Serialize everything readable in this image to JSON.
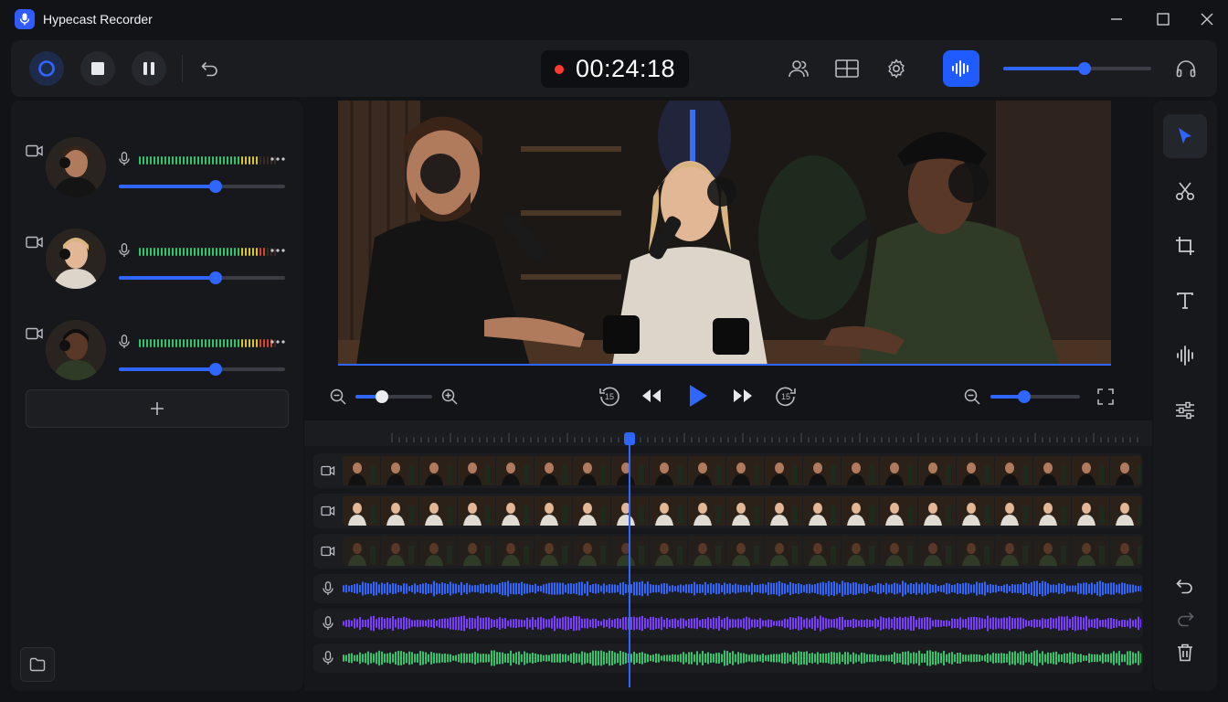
{
  "window": {
    "title": "Hypecast Recorder",
    "minimize_icon": "minimize-icon",
    "maximize_icon": "maximize-icon",
    "close_icon": "close-icon"
  },
  "toolbar": {
    "buttons": [
      "record-icon",
      "stop-icon",
      "pause-icon",
      "undo-icon"
    ],
    "timer": "00:24:18",
    "recording_indicator_color": "#ff3b30",
    "right_icons": [
      "participants-icon",
      "layout-icon",
      "settings-icon",
      "audio-wave-icon",
      "headphones-icon"
    ],
    "output_volume": 0.55
  },
  "participants": [
    {
      "meter_level": 0.85,
      "volume": 0.58
    },
    {
      "meter_level": 0.9,
      "volume": 0.58
    },
    {
      "meter_level": 0.95,
      "volume": 0.58
    }
  ],
  "sidebar": {
    "add_icon": "plus-icon",
    "folder_icon": "folder-icon"
  },
  "preview": {
    "zoom_level": 0.35,
    "skip_back_label": "15",
    "skip_forward_label": "15",
    "timeline_zoom": 0.38
  },
  "timeline": {
    "video_tracks": 3,
    "audio_tracks": [
      {
        "color": "#2f66ff"
      },
      {
        "color": "#7a3cff"
      },
      {
        "color": "#2fc46d"
      }
    ],
    "playhead_fraction": 0.35
  },
  "tools": [
    "select-icon",
    "scissors-icon",
    "crop-icon",
    "text-icon",
    "audio-icon",
    "adjust-icon"
  ],
  "history": [
    "undo-icon",
    "redo-icon",
    "delete-icon"
  ],
  "colors": {
    "accent": "#2f66ff",
    "background": "#111316",
    "panel": "#16181b"
  }
}
